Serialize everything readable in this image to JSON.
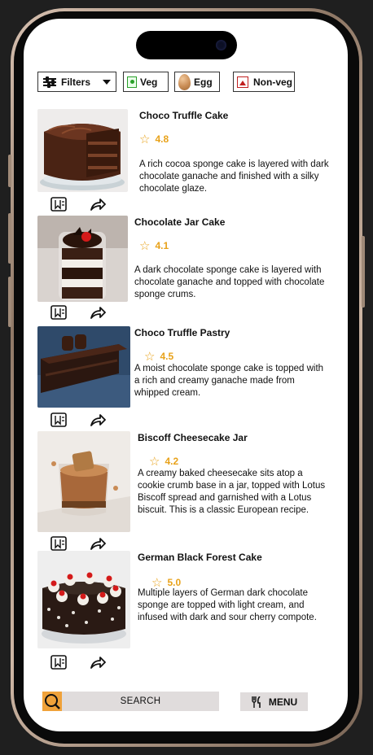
{
  "filters": {
    "filters_label": "Filters",
    "veg_label": "Veg",
    "egg_label": "Egg",
    "nonveg_label": "Non-veg"
  },
  "items": [
    {
      "title": "Choco Truffle Cake",
      "rating": "4.8",
      "description": "A rich cocoa sponge cake is layered with dark chocolate ganache and finished with a silky chocolate glaze."
    },
    {
      "title": "Chocolate Jar Cake",
      "rating": "4.1",
      "description": "A dark chocolate sponge cake is layered with chocolate ganache and topped with chocolate sponge crums."
    },
    {
      "title": "Choco Truffle Pastry",
      "rating": "4.5",
      "description": "A moist chocolate sponge cake is topped with a rich and creamy ganache made from whipped cream."
    },
    {
      "title": "Biscoff Cheesecake Jar",
      "rating": "4.2",
      "description": "A creamy baked cheesecake sits atop a cookie crumb base in a jar, topped with Lotus Biscoff spread and garnished with a Lotus biscuit. This is a classic European recipe."
    },
    {
      "title": "German Black Forest Cake",
      "rating": "5.0",
      "description": "Multiple layers of German dark chocolate sponge are topped with light cream, and infused with dark and sour cherry compote."
    }
  ],
  "bottom": {
    "search_label": "SEARCH",
    "menu_label": "MENU"
  },
  "colors": {
    "accent_orange": "#f0a23a",
    "rating_gold": "#e8a21a",
    "veg_green": "#2aa02a",
    "nonveg_red": "#c12020"
  }
}
